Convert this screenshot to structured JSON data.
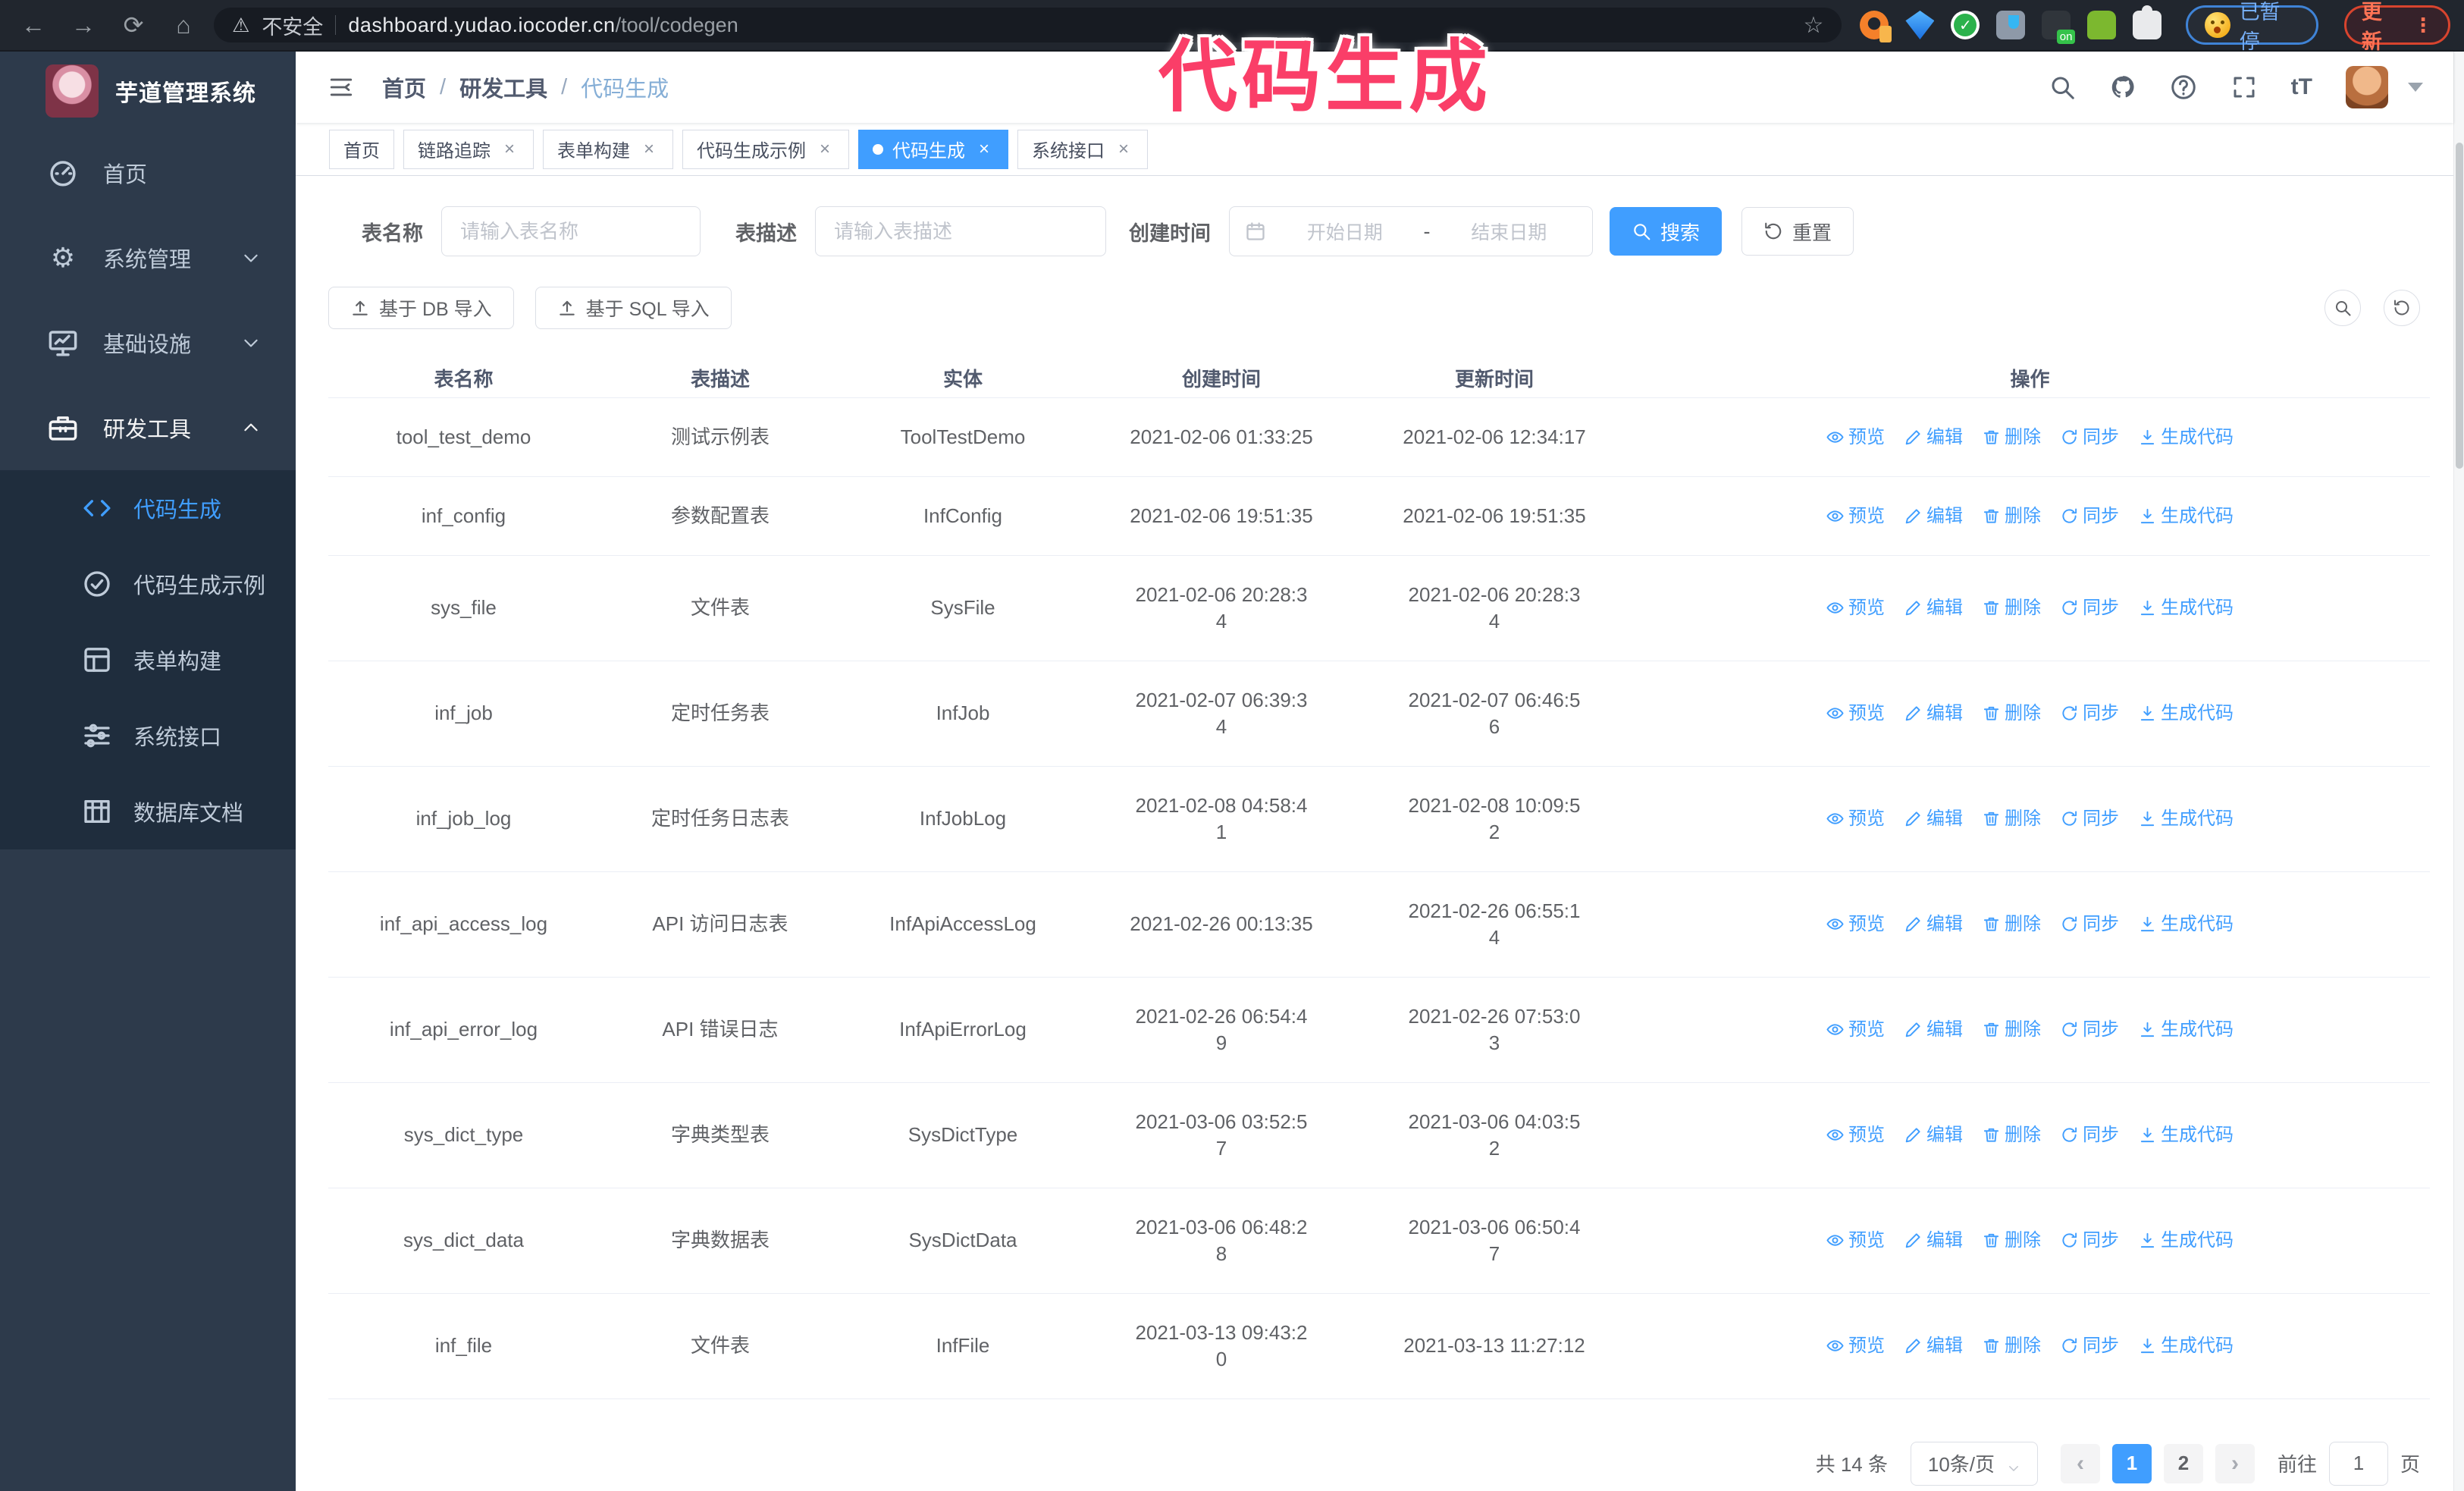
{
  "browser": {
    "security_label": "不安全",
    "url_domain": "dashboard.yudao.iocoder.cn",
    "url_path": "/tool/codegen",
    "profile_status": "已暂停",
    "update_label": "更新",
    "update_dots": "⋮"
  },
  "annotation": {
    "text": "代码生成"
  },
  "sidebar": {
    "logo_title": "芋道管理系统",
    "items": [
      {
        "label": "首页"
      },
      {
        "label": "系统管理"
      },
      {
        "label": "基础设施"
      },
      {
        "label": "研发工具"
      }
    ],
    "sub_items": [
      {
        "label": "代码生成"
      },
      {
        "label": "代码生成示例"
      },
      {
        "label": "表单构建"
      },
      {
        "label": "系统接口"
      },
      {
        "label": "数据库文档"
      }
    ]
  },
  "header": {
    "breadcrumb": [
      {
        "label": "首页"
      },
      {
        "label": "研发工具"
      },
      {
        "label": "代码生成"
      }
    ],
    "tabs": [
      {
        "label": "首页"
      },
      {
        "label": "链路追踪"
      },
      {
        "label": "表单构建"
      },
      {
        "label": "代码生成示例"
      },
      {
        "label": "代码生成"
      },
      {
        "label": "系统接口"
      }
    ]
  },
  "filters": {
    "table_name_label": "表名称",
    "table_name_placeholder": "请输入表名称",
    "table_desc_label": "表描述",
    "table_desc_placeholder": "请输入表描述",
    "create_time_label": "创建时间",
    "date_start_placeholder": "开始日期",
    "date_separator": "-",
    "date_end_placeholder": "结束日期",
    "search_label": "搜索",
    "reset_label": "重置"
  },
  "toolbar": {
    "import_db_label": "基于 DB 导入",
    "import_sql_label": "基于 SQL 导入"
  },
  "table": {
    "columns": [
      "表名称",
      "表描述",
      "实体",
      "创建时间",
      "更新时间",
      "操作"
    ],
    "actions": [
      "预览",
      "编辑",
      "删除",
      "同步",
      "生成代码"
    ],
    "rows": [
      {
        "name": "tool_test_demo",
        "desc": "测试示例表",
        "entity": "ToolTestDemo",
        "created": "2021-02-06 01:33:25",
        "updated": "2021-02-06 12:34:17"
      },
      {
        "name": "inf_config",
        "desc": "参数配置表",
        "entity": "InfConfig",
        "created": "2021-02-06 19:51:35",
        "updated": "2021-02-06 19:51:35"
      },
      {
        "name": "sys_file",
        "desc": "文件表",
        "entity": "SysFile",
        "created": "2021-02-06 20:28:3\n4",
        "updated": "2021-02-06 20:28:3\n4"
      },
      {
        "name": "inf_job",
        "desc": "定时任务表",
        "entity": "InfJob",
        "created": "2021-02-07 06:39:3\n4",
        "updated": "2021-02-07 06:46:5\n6"
      },
      {
        "name": "inf_job_log",
        "desc": "定时任务日志表",
        "entity": "InfJobLog",
        "created": "2021-02-08 04:58:4\n1",
        "updated": "2021-02-08 10:09:5\n2"
      },
      {
        "name": "inf_api_access_log",
        "desc": "API 访问日志表",
        "entity": "InfApiAccessLog",
        "created": "2021-02-26 00:13:35",
        "updated": "2021-02-26 06:55:1\n4"
      },
      {
        "name": "inf_api_error_log",
        "desc": "API 错误日志",
        "entity": "InfApiErrorLog",
        "created": "2021-02-26 06:54:4\n9",
        "updated": "2021-02-26 07:53:0\n3"
      },
      {
        "name": "sys_dict_type",
        "desc": "字典类型表",
        "entity": "SysDictType",
        "created": "2021-03-06 03:52:5\n7",
        "updated": "2021-03-06 04:03:5\n2"
      },
      {
        "name": "sys_dict_data",
        "desc": "字典数据表",
        "entity": "SysDictData",
        "created": "2021-03-06 06:48:2\n8",
        "updated": "2021-03-06 06:50:4\n7"
      },
      {
        "name": "inf_file",
        "desc": "文件表",
        "entity": "InfFile",
        "created": "2021-03-13 09:43:2\n0",
        "updated": "2021-03-13 11:27:12"
      }
    ]
  },
  "pagination": {
    "total_label": "共 14 条",
    "page_size_label": "10条/页",
    "prev_label": "‹",
    "page_1": "1",
    "page_2": "2",
    "next_label": "›",
    "goto_label": "前往",
    "goto_value": "1",
    "page_unit_label": "页"
  },
  "colors": {
    "primary": "#409eff",
    "annotation": "#fa3e68",
    "sidebar_bg": "#2d3a4b",
    "submenu_bg": "#1f2d3d"
  }
}
